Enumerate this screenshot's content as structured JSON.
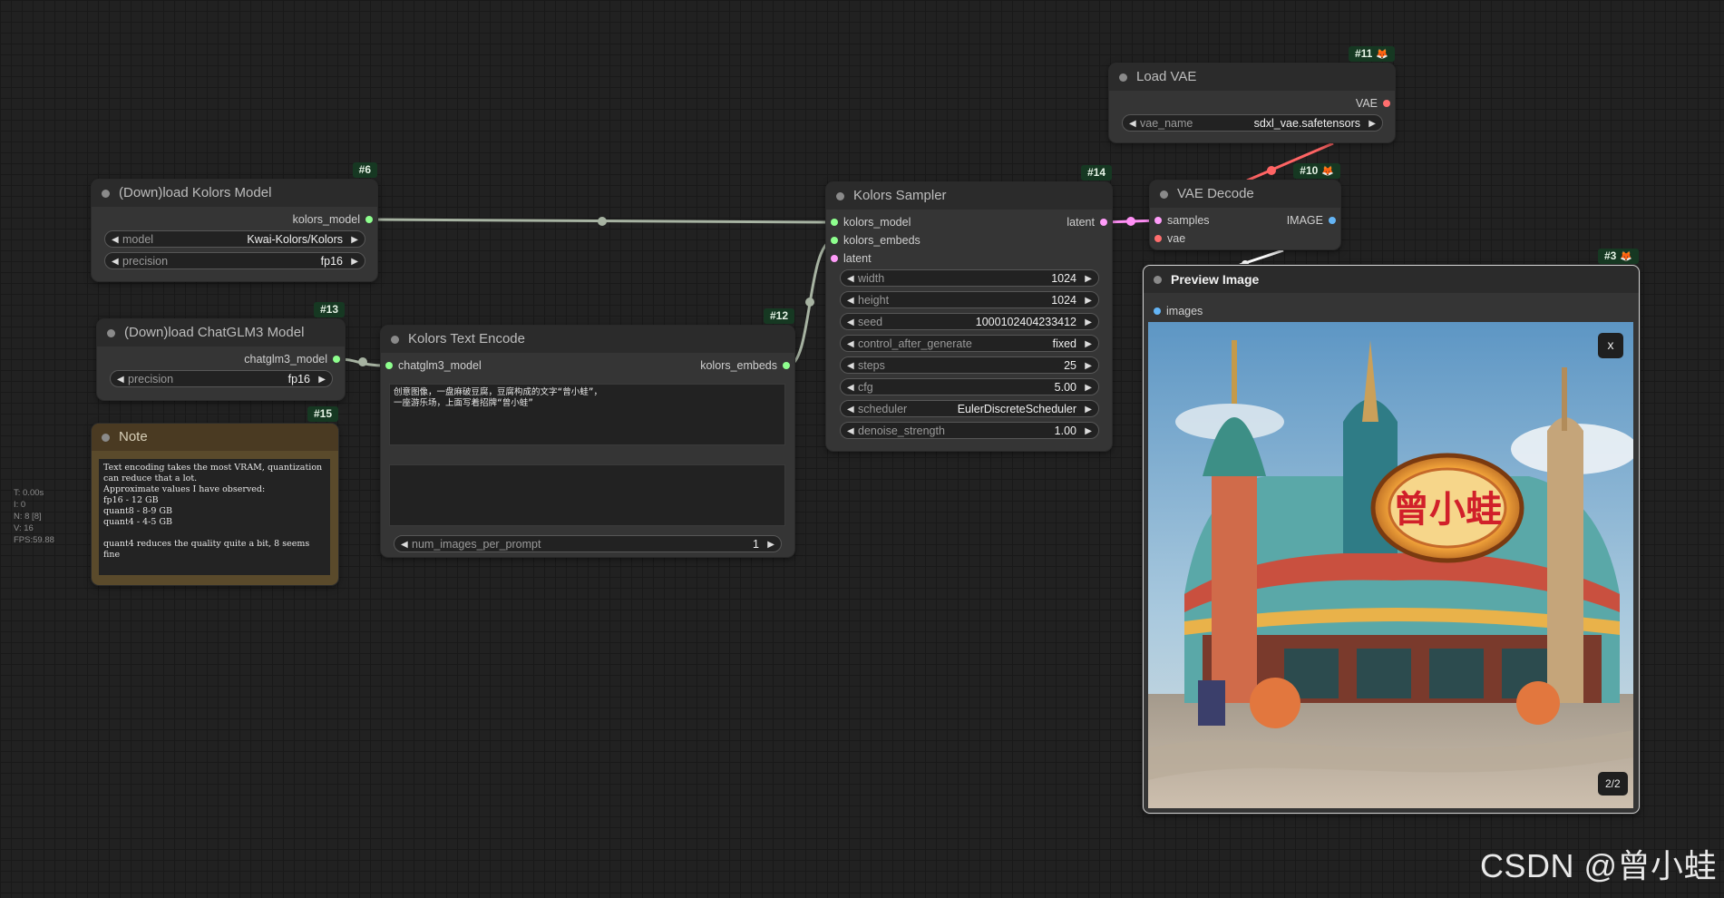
{
  "stats": {
    "t": "T: 0.00s",
    "i": "I: 0",
    "n": "N: 8 [8]",
    "v": "V: 16",
    "fps": "FPS:59.88"
  },
  "nodes": {
    "kolors_model": {
      "id": "#6",
      "title": "(Down)load Kolors Model",
      "output": "kolors_model",
      "widgets": [
        {
          "label": "model",
          "value": "Kwai-Kolors/Kolors"
        },
        {
          "label": "precision",
          "value": "fp16"
        }
      ]
    },
    "chatglm": {
      "id": "#13",
      "title": "(Down)load ChatGLM3 Model",
      "output": "chatglm3_model",
      "widgets": [
        {
          "label": "precision",
          "value": "fp16"
        }
      ]
    },
    "note": {
      "id": "#15",
      "title": "Note",
      "text": "Text encoding takes the most VRAM, quantization can reduce that a lot.\nApproximate values I have observed:\nfp16 - 12 GB\nquant8 - 8-9 GB\nquant4 - 4-5 GB\n\nquant4 reduces the quality quite a bit, 8 seems fine"
    },
    "text_encode": {
      "id": "#12",
      "title": "Kolors Text Encode",
      "input": "chatglm3_model",
      "output": "kolors_embeds",
      "prompt": "创意图像，一盘麻破豆腐，豆腐构成的文字“曾小蛙”，\n一座游乐场，上面写着招牌“曾小蛙”",
      "negative": "",
      "widgets": [
        {
          "label": "num_images_per_prompt",
          "value": "1"
        }
      ]
    },
    "sampler": {
      "id": "#14",
      "title": "Kolors Sampler",
      "inputs": [
        "kolors_model",
        "kolors_embeds",
        "latent"
      ],
      "output": "latent",
      "widgets": [
        {
          "label": "width",
          "value": "1024"
        },
        {
          "label": "height",
          "value": "1024"
        },
        {
          "label": "seed",
          "value": "1000102404233412"
        },
        {
          "label": "control_after_generate",
          "value": "fixed"
        },
        {
          "label": "steps",
          "value": "25"
        },
        {
          "label": "cfg",
          "value": "5.00"
        },
        {
          "label": "scheduler",
          "value": "EulerDiscreteScheduler"
        },
        {
          "label": "denoise_strength",
          "value": "1.00"
        }
      ]
    },
    "load_vae": {
      "id": "#11",
      "title": "Load VAE",
      "output": "VAE",
      "widgets": [
        {
          "label": "vae_name",
          "value": "sdxl_vae.safetensors"
        }
      ]
    },
    "vae_decode": {
      "id": "#10",
      "title": "VAE Decode",
      "inputs": [
        "samples",
        "vae"
      ],
      "output": "IMAGE"
    },
    "preview": {
      "id": "#3",
      "title": "Preview Image",
      "input": "images",
      "close": "x",
      "counter": "2/2",
      "sign_text": "曾小蛙"
    }
  },
  "colors": {
    "latent": "#ff9cf9",
    "vae": "#ff6e6e",
    "image": "#64b5f6",
    "generic": "#8eff8e",
    "link": "#9aa59a"
  },
  "watermark": "CSDN @曾小蛙"
}
